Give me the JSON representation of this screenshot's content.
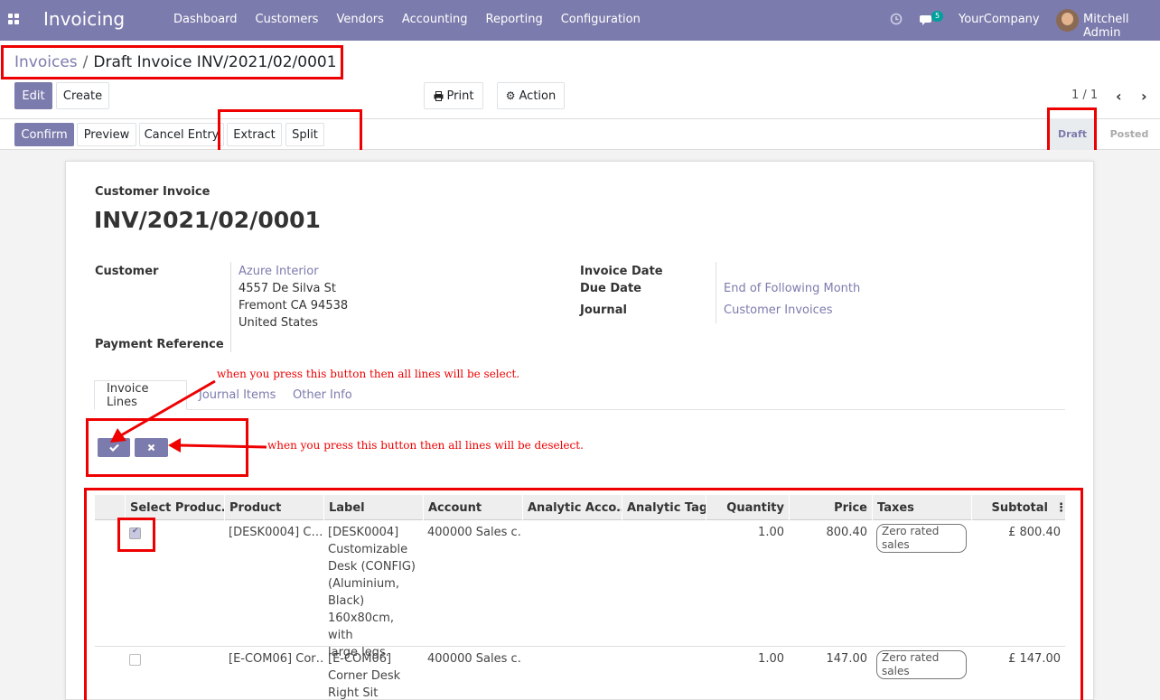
{
  "navbar": {
    "brand": "Invoicing",
    "menu": [
      "Dashboard",
      "Customers",
      "Vendors",
      "Accounting",
      "Reporting",
      "Configuration"
    ],
    "messages_count": "5",
    "company": "YourCompany",
    "user": "Mitchell Admin"
  },
  "breadcrumb": {
    "parent": "Invoices",
    "current": "Draft Invoice INV/2021/02/0001"
  },
  "control": {
    "edit": "Edit",
    "create": "Create",
    "print": "Print",
    "action": "Action",
    "pager": "1 / 1"
  },
  "statusbar": {
    "buttons": [
      "Confirm",
      "Preview",
      "Cancel Entry",
      "Extract",
      "Split"
    ],
    "states": [
      "Draft",
      "Posted"
    ]
  },
  "invoice": {
    "type": "Customer Invoice",
    "number": "INV/2021/02/0001",
    "customer_label": "Customer",
    "customer_name": "Azure Interior",
    "address": [
      "4557 De Silva St",
      "Fremont CA 94538",
      "United States"
    ],
    "payment_ref_label": "Payment Reference",
    "invoice_date_label": "Invoice Date",
    "due_date_label": "Due Date",
    "due_date_value": "End of Following Month",
    "journal_label": "Journal",
    "journal_value": "Customer Invoices"
  },
  "tabs": [
    "Invoice Lines",
    "Journal Items",
    "Other Info"
  ],
  "annotations": {
    "select_all": "when you press this button then all lines will be select.",
    "deselect_all": "when you press this button then all lines will be deselect."
  },
  "table": {
    "columns": [
      "Select Produc…",
      "Product",
      "Label",
      "Account",
      "Analytic Acco…",
      "Analytic Tags",
      "Quantity",
      "Price",
      "Taxes",
      "Subtotal"
    ],
    "rows": [
      {
        "selected": true,
        "product": "[DESK0004] C…",
        "label": [
          "[DESK0004]",
          "Customizable",
          "Desk (CONFIG)",
          "(Aluminium,",
          "Black)",
          "160x80cm, with",
          "large legs."
        ],
        "account": "400000 Sales c…",
        "quantity": "1.00",
        "price": "800.40",
        "tax": "Zero rated sales",
        "subtotal": "£ 800.40"
      },
      {
        "selected": false,
        "product": "[E-COM06] Cor…",
        "label": [
          "[E-COM06]",
          "Corner Desk",
          "Right Sit"
        ],
        "account": "400000 Sales c…",
        "quantity": "1.00",
        "price": "147.00",
        "tax": "Zero rated sales",
        "subtotal": "£ 147.00"
      }
    ]
  }
}
